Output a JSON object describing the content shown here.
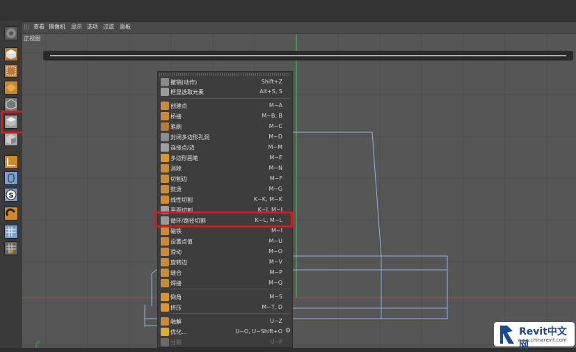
{
  "viewport": {
    "menu": [
      "查看",
      "摄像机",
      "显示",
      "选项",
      "过滤",
      "面板"
    ],
    "view_name": "正视图"
  },
  "context_menu": {
    "items": [
      {
        "label": "撤销(动作)",
        "shortcut": "Shift+Z",
        "icon_color": "#8a8a8a",
        "icon": "undo-icon"
      },
      {
        "label": "框显选取元素",
        "shortcut": "Alt+S, S",
        "icon_color": "#9a9a9a",
        "icon": "frame-selection-icon"
      },
      {
        "label": "创建点",
        "shortcut": "M~A",
        "icon_color": "#c98a3a",
        "icon": "create-point-icon"
      },
      {
        "label": "桥接",
        "shortcut": "M~B, B",
        "icon_color": "#c98a3a",
        "icon": "bridge-icon"
      },
      {
        "label": "笔刷",
        "shortcut": "M~C",
        "icon_color": "#b57a3a",
        "icon": "brush-icon"
      },
      {
        "label": "封闭多边形孔洞",
        "shortcut": "M~D",
        "icon_color": "#8d8d8d",
        "icon": "close-hole-icon"
      },
      {
        "label": "连接点/边",
        "shortcut": "M~M",
        "icon_color": "#a0a0a0",
        "icon": "connect-points-edges-icon"
      },
      {
        "label": "多边形画笔",
        "shortcut": "M~E",
        "icon_color": "#d9952e",
        "icon": "polygon-pen-icon"
      },
      {
        "label": "消除",
        "shortcut": "M~N",
        "icon_color": "#c98a3a",
        "icon": "dissolve-icon"
      },
      {
        "label": "切割边",
        "shortcut": "M~F",
        "icon_color": "#c98a3a",
        "icon": "edge-cut-icon"
      },
      {
        "label": "熨烫",
        "shortcut": "M~G",
        "icon_color": "#c98a3a",
        "icon": "iron-icon"
      },
      {
        "label": "线性切割",
        "shortcut": "K~K, M~K",
        "icon_color": "#d08a2a",
        "icon": "line-cut-icon"
      },
      {
        "label": "平面切割",
        "shortcut": "K~J, M~J",
        "icon_color": "#a0a0a0",
        "icon": "plane-cut-icon"
      },
      {
        "label": "循环/路径切割",
        "shortcut": "K~L, M~L",
        "icon_color": "#9a9a9a",
        "icon": "loop-path-cut-icon"
      },
      {
        "label": "磁铁",
        "shortcut": "M~I",
        "icon_color": "#c98a3a",
        "icon": "magnet-icon"
      },
      {
        "label": "设置点值",
        "shortcut": "M~U",
        "icon_color": "#c98a3a",
        "icon": "set-point-value-icon"
      },
      {
        "label": "滑动",
        "shortcut": "M~O",
        "icon_color": "#c98a3a",
        "icon": "slide-icon"
      },
      {
        "label": "旋转边",
        "shortcut": "M~V",
        "icon_color": "#c98a3a",
        "icon": "spin-edge-icon"
      },
      {
        "label": "缝合",
        "shortcut": "M~P",
        "icon_color": "#c98a3a",
        "icon": "stitch-icon"
      },
      {
        "label": "焊接",
        "shortcut": "M~Q",
        "icon_color": "#c98a3a",
        "icon": "weld-icon"
      },
      {
        "label": "倒角",
        "shortcut": "M~S",
        "icon_color": "#d9952e",
        "icon": "bevel-icon"
      },
      {
        "label": "挤压",
        "shortcut": "M~T, D",
        "icon_color": "#d9952e",
        "icon": "extrude-icon"
      },
      {
        "label": "融解",
        "shortcut": "U~Z",
        "icon_color": "#c98a3a",
        "icon": "melt-icon"
      },
      {
        "label": "优化...",
        "shortcut": "U~O, U~Shift+O",
        "icon_color": "#d9b02e",
        "icon": "optimize-icon"
      },
      {
        "label": "分裂",
        "shortcut": "U~P",
        "icon_color": "#6a6a6a",
        "icon": "split-icon",
        "disabled": true
      }
    ]
  },
  "watermark": {
    "brand": "Revit中文网",
    "url": "www.chinarevit.com"
  },
  "colors": {
    "highlight": "#d31b1b",
    "axis_green": "#3cb043",
    "axis_red": "#d03030",
    "wireframe": "#8fb4e6"
  }
}
